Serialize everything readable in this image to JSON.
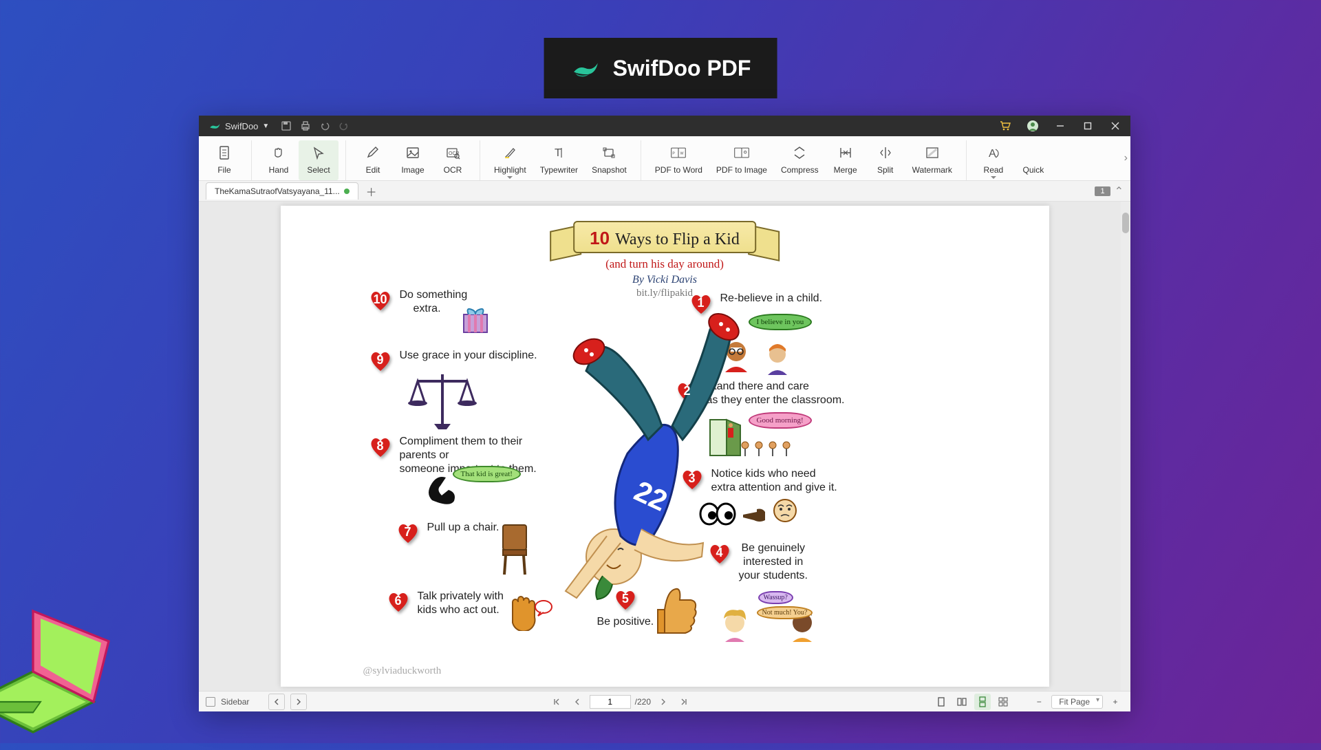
{
  "brand": {
    "name": "SwifDoo PDF"
  },
  "titlebar": {
    "app_name": "SwifDoo"
  },
  "toolbar": {
    "file": "File",
    "hand": "Hand",
    "select": "Select",
    "edit": "Edit",
    "image": "Image",
    "ocr": "OCR",
    "highlight": "Highlight",
    "typewriter": "Typewriter",
    "snapshot": "Snapshot",
    "pdf_to_word": "PDF to Word",
    "pdf_to_image": "PDF to Image",
    "compress": "Compress",
    "merge": "Merge",
    "split": "Split",
    "watermark": "Watermark",
    "read": "Read",
    "quick": "Quick"
  },
  "tabs": {
    "current": "TheKamaSutraofVatsyayana_11..."
  },
  "page_indicator": "1",
  "doc": {
    "banner_num": "10",
    "banner_text": "Ways to Flip a Kid",
    "sub_banner": "(and turn his day around)",
    "byline": "By Vicki Davis",
    "bitly": "bit.ly/flipakid",
    "handle": "@sylviaduckworth",
    "tips": {
      "t1": "Re-believe in a child.",
      "t2a": "Stand there and care",
      "t2b": "as they enter the classroom.",
      "t3a": "Notice kids who need",
      "t3b": "extra attention and give it.",
      "t4a": "Be genuinely",
      "t4b": "interested in",
      "t4c": "your students.",
      "t5": "Be positive.",
      "t6a": "Talk privately with",
      "t6b": "kids who act out.",
      "t7": "Pull up a chair.",
      "t8a": "Compliment them to their parents or",
      "t8b": "someone important to them.",
      "t9": "Use grace in your discipline.",
      "t10a": "Do something",
      "t10b": "extra."
    },
    "speech": {
      "believe": "I believe in you",
      "good_morning": "Good morning!",
      "that_kid": "That kid is great!",
      "wassup": "Wassup?",
      "not_much": "Not much! You?"
    }
  },
  "statusbar": {
    "sidebar": "Sidebar",
    "page_current": "1",
    "page_total": "/220",
    "zoom": "Fit Page"
  }
}
